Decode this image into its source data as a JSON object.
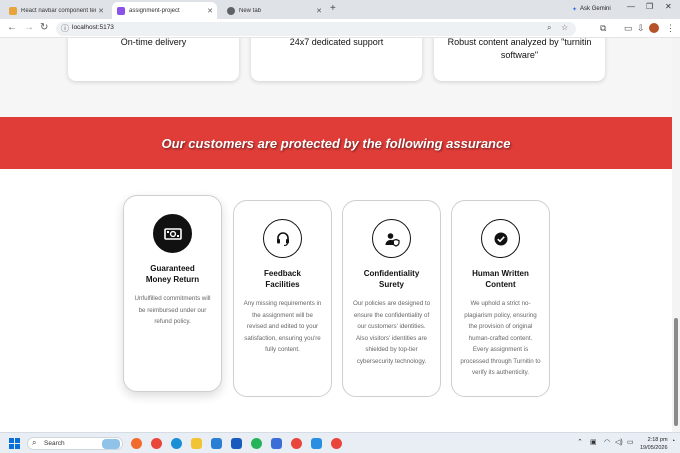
{
  "browser": {
    "tabs": [
      {
        "label": "React navbar component temp",
        "active": false,
        "favicon_color": "#e8a33c"
      },
      {
        "label": "assignment-project",
        "active": true,
        "favicon_color": "#8a52e8"
      },
      {
        "label": "New tab",
        "active": false,
        "favicon_color": "#5f6368"
      }
    ],
    "new_tab_glyph": "+",
    "ask_gemini_label": "Ask Gemini",
    "url": "localhost:5173"
  },
  "features": {
    "cards": [
      {
        "label": "On-time delivery"
      },
      {
        "label": "24x7 dedicated support"
      },
      {
        "label": "Robust content analyzed by \"turnitin software\""
      }
    ]
  },
  "assurance": {
    "heading": "Our customers are protected by the following assurance",
    "cards": [
      {
        "icon": "money-icon",
        "title": "Guaranteed Money Return",
        "description": "Unfulfilled commitments will be reimbursed under our refund policy."
      },
      {
        "icon": "headset-icon",
        "title": "Feedback Facilities",
        "description": "Any missing requirements in the assignment will be revised and edited to your satisfaction, ensuring you're fully content."
      },
      {
        "icon": "user-shield-icon",
        "title": "Confidentiality Surety",
        "description": "Our policies are designed to ensure the confidentiality of our customers' identities. Also visitors' identities are shielded by top-tier cybersecurity technology."
      },
      {
        "icon": "check-circle-icon",
        "title": "Human Written Content",
        "description": "We uphold a strict no-plagiarism policy, ensuring the provision of original human-crafted content. Every assignment is processed through Turnitin to verify its authenticity."
      }
    ]
  },
  "taskbar": {
    "search_placeholder": "Search",
    "apps": [
      "copilot-icon",
      "chrome-icon",
      "edge-icon",
      "file-explorer-icon",
      "photos-icon",
      "word-icon",
      "store-icon",
      "whatsapp-icon",
      "chrome-icon",
      "vscode-icon",
      "chrome-icon"
    ],
    "time": "2:18 pm",
    "date": "19/05/2026"
  }
}
